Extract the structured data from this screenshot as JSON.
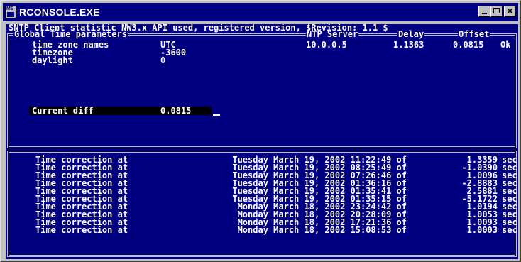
{
  "window": {
    "title": "RCONSOLE.EXE",
    "icon_label": "MS"
  },
  "status_line": "SNTP Client statistic NW3.x API used, registered version, $Revision: 1.1 $",
  "params": {
    "legend": "Global Time parameters",
    "ntp_header": "NTP Server",
    "delay_header": "Delay",
    "offset_header": "Offset",
    "rows": [
      {
        "label": "time zone names",
        "value": "UTC"
      },
      {
        "label": "timezone",
        "value": "-3600"
      },
      {
        "label": "daylight",
        "value": "0"
      }
    ],
    "ntp_server": "10.0.0.5",
    "delay": "1.1363",
    "offset": "0.0815",
    "offset_status": "Ok",
    "current_diff_label": "Current diff",
    "current_diff_value": "0.0815"
  },
  "log": [
    {
      "label": "Time correction at",
      "date": "Tuesday March 19, 2002 11:22:49 of",
      "value": "1.3359",
      "unit": "sec"
    },
    {
      "label": "Time correction at",
      "date": "Tuesday March 19, 2002 08:25:49 of",
      "value": "-1.0390",
      "unit": "sec"
    },
    {
      "label": "Time correction at",
      "date": "Tuesday March 19, 2002 07:26:46 of",
      "value": "1.0096",
      "unit": "sec"
    },
    {
      "label": "Time correction at",
      "date": "Tuesday March 19, 2002 01:36:16 of",
      "value": "-2.8883",
      "unit": "sec"
    },
    {
      "label": "Time correction at",
      "date": "Tuesday March 19, 2002 01:35:41 of",
      "value": "2.5881",
      "unit": "sec"
    },
    {
      "label": "Time correction at",
      "date": "Tuesday March 19, 2002 01:35:15 of",
      "value": "-5.1722",
      "unit": "sec"
    },
    {
      "label": "Time correction at",
      "date": "Monday March 18, 2002 23:24:42 of",
      "value": "1.0194",
      "unit": "sec"
    },
    {
      "label": "Time correction at",
      "date": "Monday March 18, 2002 20:28:09 of",
      "value": "1.0053",
      "unit": "sec"
    },
    {
      "label": "Time correction at",
      "date": "Monday March 18, 2002 17:21:36 of",
      "value": "1.0093",
      "unit": "sec"
    },
    {
      "label": "Time correction at",
      "date": "Monday March 18, 2002 15:08:53 of",
      "value": "1.0003",
      "unit": "sec"
    }
  ],
  "colors": {
    "console_bg": "#000080",
    "text": "#ffffff",
    "titlebar": "#000080",
    "chrome": "#c0c0c0"
  }
}
